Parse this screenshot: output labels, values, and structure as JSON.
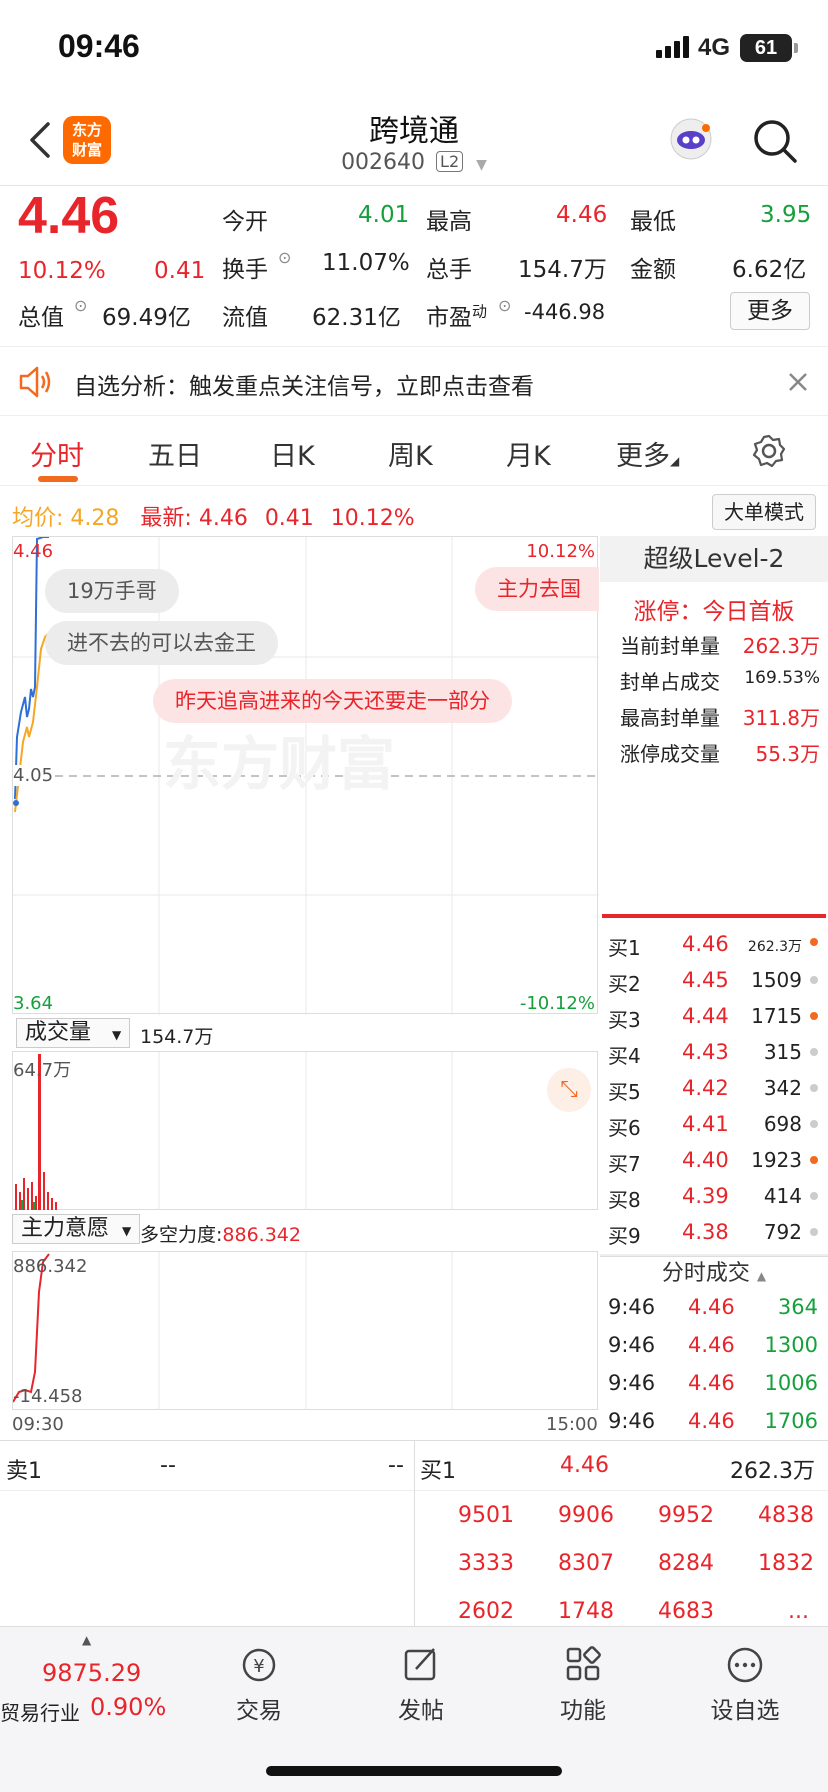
{
  "status": {
    "time": "09:46",
    "network": "4G",
    "battery": "61"
  },
  "header": {
    "title": "跨境通",
    "code": "002640",
    "level": "L2",
    "logo_text": "东方\n财富"
  },
  "quote": {
    "price": "4.46",
    "change_pct": "10.12%",
    "change": "0.41",
    "rows": [
      {
        "label": "今开",
        "value": "4.01",
        "color": "green"
      },
      {
        "label": "最高",
        "value": "4.46",
        "color": "red"
      },
      {
        "label": "最低",
        "value": "3.95",
        "color": "green"
      },
      {
        "label": "换手",
        "value": "11.07%",
        "color": "default"
      },
      {
        "label": "总手",
        "value": "154.7万",
        "color": "default"
      },
      {
        "label": "金额",
        "value": "6.62亿",
        "color": "default"
      },
      {
        "label": "总值",
        "value": "69.49亿",
        "color": "default"
      },
      {
        "label": "流值",
        "value": "62.31亿",
        "color": "default"
      },
      {
        "label": "市盈",
        "sup": "动",
        "value": "-446.98",
        "color": "default"
      }
    ],
    "more": "更多"
  },
  "notice": {
    "text": "自选分析：触发重点关注信号，立即点击查看"
  },
  "tabs": [
    "分时",
    "五日",
    "日K",
    "周K",
    "月K",
    "更多"
  ],
  "priceline": {
    "avg_label": "均价:",
    "avg": "4.28",
    "latest_label": "最新:",
    "latest": "4.46",
    "chg": "0.41",
    "pct": "10.12%",
    "mode_button": "大单模式"
  },
  "chart": {
    "top_price": "4.46",
    "top_pct": "10.12%",
    "mid_price": "4.05",
    "bottom_price": "3.64",
    "bottom_pct": "-10.12%",
    "watermark": "东方财富",
    "bubbles": [
      "19万手哥",
      "进不去的可以去金王",
      "昨天追高进来的今天还要走一部分",
      "主力去国"
    ]
  },
  "level2": {
    "title": "超级Level-2",
    "limit_label": "涨停：今日首板",
    "stats": [
      {
        "label": "当前封单量",
        "value": "262.3万"
      },
      {
        "label": "封单占成交",
        "value": "169.53%"
      },
      {
        "label": "最高封单量",
        "value": "311.8万"
      },
      {
        "label": "涨停成交量",
        "value": "55.3万"
      }
    ],
    "bids": [
      {
        "label": "买1",
        "price": "4.46",
        "vol": "262.3万",
        "dot": "orange"
      },
      {
        "label": "买2",
        "price": "4.45",
        "vol": "1509",
        "dot": "gray"
      },
      {
        "label": "买3",
        "price": "4.44",
        "vol": "1715",
        "dot": "orange"
      },
      {
        "label": "买4",
        "price": "4.43",
        "vol": "315",
        "dot": "gray"
      },
      {
        "label": "买5",
        "price": "4.42",
        "vol": "342",
        "dot": "gray"
      },
      {
        "label": "买6",
        "price": "4.41",
        "vol": "698",
        "dot": "gray"
      },
      {
        "label": "买7",
        "price": "4.40",
        "vol": "1923",
        "dot": "orange"
      },
      {
        "label": "买8",
        "price": "4.39",
        "vol": "414",
        "dot": "gray"
      },
      {
        "label": "买9",
        "price": "4.38",
        "vol": "792",
        "dot": "gray"
      }
    ],
    "trades_title": "分时成交",
    "trades": [
      {
        "time": "9:46",
        "price": "4.46",
        "vol": "364"
      },
      {
        "time": "9:46",
        "price": "4.46",
        "vol": "1300"
      },
      {
        "time": "9:46",
        "price": "4.46",
        "vol": "1006"
      },
      {
        "time": "9:46",
        "price": "4.46",
        "vol": "1706"
      }
    ]
  },
  "volume": {
    "selector": "成交量",
    "total": "154.7万",
    "max": "64.7万"
  },
  "force": {
    "selector": "主力意愿",
    "label": "多空力度:",
    "value": "886.342",
    "top": "886.342",
    "bottom": "-14.458",
    "start_time": "09:30",
    "end_time": "15:00"
  },
  "orderbook": {
    "sell_label": "卖1",
    "sell_price": "--",
    "sell_vol": "--",
    "buy_label": "买1",
    "buy_price": "4.46",
    "buy_vol": "262.3万",
    "queue": [
      [
        "9501",
        "9906",
        "9952",
        "4838"
      ],
      [
        "3333",
        "8307",
        "8284",
        "1832"
      ],
      [
        "2602",
        "1748",
        "4683",
        "..."
      ]
    ]
  },
  "bottomnav": {
    "index_value": "9875.29",
    "index_name": "贸易行业",
    "index_pct": "0.90%",
    "items": [
      "交易",
      "发帖",
      "功能",
      "设自选"
    ]
  }
}
